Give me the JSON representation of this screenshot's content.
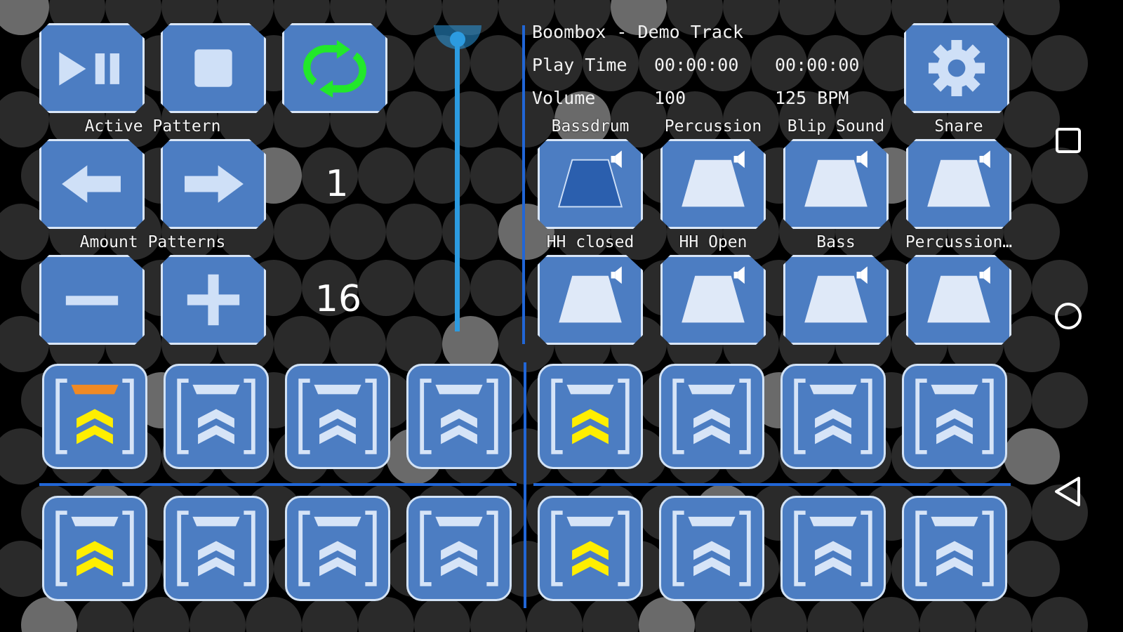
{
  "colors": {
    "button_fill": "#4c7dc2",
    "button_border": "#d9e6f7",
    "accent_blue": "#2166d6",
    "slider_blue": "#2c9be0",
    "loop_green": "#22e82a",
    "active_orange": "#f08a24",
    "active_yellow": "#ffee00"
  },
  "transport": {
    "play_pause_icon": "play-pause-icon",
    "stop_icon": "stop-icon",
    "loop_icon": "loop-icon"
  },
  "active_pattern": {
    "label": "Active Pattern",
    "value": "1"
  },
  "amount_patterns": {
    "label": "Amount Patterns",
    "value": "16"
  },
  "volume_slider": {
    "level": 1.0
  },
  "track": {
    "title": "Boombox - Demo Track",
    "play_time_label": "Play Time",
    "play_time_current": "00:00:00",
    "play_time_total": "00:00:00",
    "volume_label": "Volume",
    "volume_value": "100",
    "bpm": "125 BPM"
  },
  "settings": {
    "icon": "gear-icon"
  },
  "instruments": [
    {
      "name": "Bassdrum",
      "active": true
    },
    {
      "name": "Percussion",
      "active": false
    },
    {
      "name": "Blip Sound",
      "active": false
    },
    {
      "name": "Snare",
      "active": false
    },
    {
      "name": "HH closed",
      "active": false
    },
    {
      "name": "HH Open",
      "active": false
    },
    {
      "name": "Bass",
      "active": false
    },
    {
      "name": "Percussion…",
      "active": false
    }
  ],
  "steps": [
    {
      "step": 1,
      "current": true,
      "active": true
    },
    {
      "step": 2,
      "current": false,
      "active": false
    },
    {
      "step": 3,
      "current": false,
      "active": false
    },
    {
      "step": 4,
      "current": false,
      "active": false
    },
    {
      "step": 5,
      "current": false,
      "active": true
    },
    {
      "step": 6,
      "current": false,
      "active": false
    },
    {
      "step": 7,
      "current": false,
      "active": false
    },
    {
      "step": 8,
      "current": false,
      "active": false
    },
    {
      "step": 9,
      "current": false,
      "active": true
    },
    {
      "step": 10,
      "current": false,
      "active": false
    },
    {
      "step": 11,
      "current": false,
      "active": false
    },
    {
      "step": 12,
      "current": false,
      "active": false
    },
    {
      "step": 13,
      "current": false,
      "active": true
    },
    {
      "step": 14,
      "current": false,
      "active": false
    },
    {
      "step": 15,
      "current": false,
      "active": false
    },
    {
      "step": 16,
      "current": false,
      "active": false
    }
  ],
  "nav": {
    "recents_icon": "square-recents-icon",
    "home_icon": "circle-home-icon",
    "back_icon": "triangle-back-icon"
  }
}
